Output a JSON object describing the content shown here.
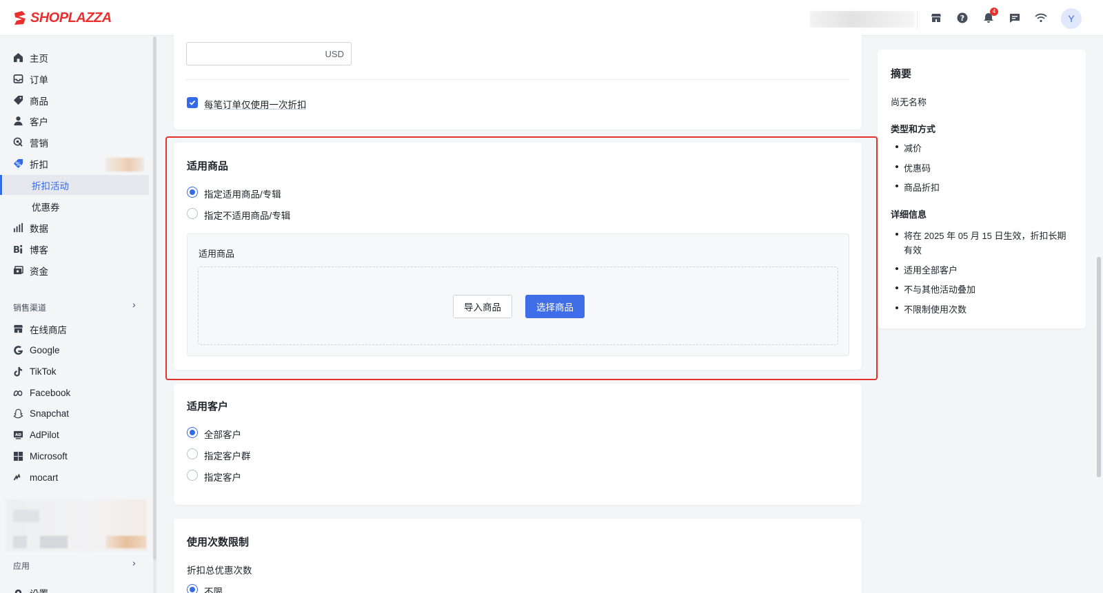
{
  "brand": {
    "name": "SHOPLAZZA",
    "color": "#e8312f"
  },
  "topbar": {
    "icons": [
      "store-icon",
      "help-icon",
      "bell-icon",
      "chat-icon",
      "wifi-icon"
    ],
    "notification_count": "4",
    "avatar_initial": "Y"
  },
  "sidebar": {
    "items": [
      {
        "label": "主页",
        "icon": "home-icon"
      },
      {
        "label": "订单",
        "icon": "inbox-icon"
      },
      {
        "label": "商品",
        "icon": "tag-icon"
      },
      {
        "label": "客户",
        "icon": "user-icon"
      },
      {
        "label": "营销",
        "icon": "marketing-icon"
      },
      {
        "label": "折扣",
        "icon": "discount-icon"
      }
    ],
    "sub_items": [
      {
        "label": "折扣活动",
        "active": true
      },
      {
        "label": "优惠券",
        "active": false
      }
    ],
    "items2": [
      {
        "label": "数据",
        "icon": "chart-icon"
      },
      {
        "label": "博客",
        "icon": "blog-icon"
      },
      {
        "label": "资金",
        "icon": "wallet-icon"
      }
    ],
    "channels_label": "销售渠道",
    "channels": [
      {
        "label": "在线商店",
        "icon": "store-icon"
      },
      {
        "label": "Google",
        "icon": "google-icon"
      },
      {
        "label": "TikTok",
        "icon": "tiktok-icon"
      },
      {
        "label": "Facebook",
        "icon": "meta-icon"
      },
      {
        "label": "Snapchat",
        "icon": "snapchat-icon"
      },
      {
        "label": "AdPilot",
        "icon": "adpilot-icon"
      },
      {
        "label": "Microsoft",
        "icon": "microsoft-icon"
      },
      {
        "label": "mocart",
        "icon": "mocart-icon"
      }
    ],
    "apps_label": "应用",
    "settings_label": "设置"
  },
  "top_card": {
    "currency_suffix": "USD",
    "once_per_order_label": "每笔订单仅使用一次折扣",
    "once_per_order_checked": true
  },
  "products_card": {
    "title": "适用商品",
    "options": [
      {
        "label": "指定适用商品/专辑",
        "selected": true
      },
      {
        "label": "指定不适用商品/专辑",
        "selected": false
      }
    ],
    "box_title": "适用商品",
    "import_button": "导入商品",
    "select_button": "选择商品"
  },
  "customers_card": {
    "title": "适用客户",
    "options": [
      {
        "label": "全部客户",
        "selected": true
      },
      {
        "label": "指定客户群",
        "selected": false
      },
      {
        "label": "指定客户",
        "selected": false
      }
    ]
  },
  "usage_card": {
    "title": "使用次数限制",
    "subtitle": "折扣总优惠次数",
    "option": "不限"
  },
  "summary": {
    "title": "摘要",
    "name": "尚无名称",
    "type_heading": "类型和方式",
    "type_items": [
      "减价",
      "优惠码",
      "商品折扣"
    ],
    "detail_heading": "详细信息",
    "detail_items": [
      "将在 2025 年 05 月 15 日生效，折扣长期有效",
      "适用全部客户",
      "不与其他活动叠加",
      "不限制使用次数"
    ]
  }
}
